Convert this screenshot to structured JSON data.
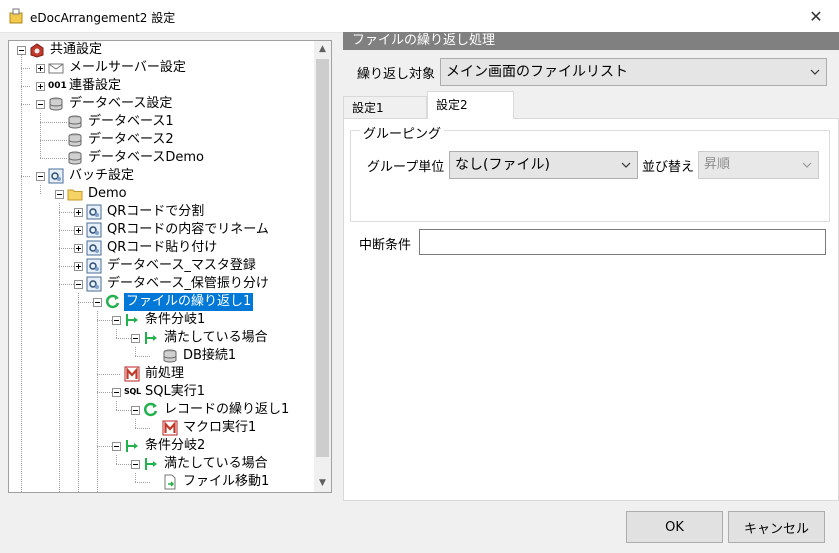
{
  "window": {
    "title": "eDocArrangement2 設定",
    "close_glyph": "✕"
  },
  "tree": {
    "nodes": [
      {
        "label": "共通設定",
        "icon": "gear-box-icon"
      },
      {
        "label": "メールサーバー設定",
        "icon": "mail-icon"
      },
      {
        "label": "連番設定",
        "icon": "number-icon",
        "icon_text": "001"
      },
      {
        "label": "データベース設定",
        "icon": "database-icon"
      },
      {
        "label": "データベース1",
        "icon": "database-icon"
      },
      {
        "label": "データベース2",
        "icon": "database-icon"
      },
      {
        "label": "データベースDemo",
        "icon": "database-icon"
      },
      {
        "label": "バッチ設定",
        "icon": "batch-icon"
      },
      {
        "label": "Demo",
        "icon": "folder-icon"
      },
      {
        "label": "QRコードで分割",
        "icon": "batch-icon"
      },
      {
        "label": "QRコードの内容でリネーム",
        "icon": "batch-icon"
      },
      {
        "label": "QRコード貼り付け",
        "icon": "batch-icon"
      },
      {
        "label": "データベース_マスタ登録",
        "icon": "batch-icon"
      },
      {
        "label": "データベース_保管振り分け",
        "icon": "batch-icon"
      },
      {
        "label": "ファイルの繰り返し1",
        "icon": "loop-icon"
      },
      {
        "label": "条件分岐1",
        "icon": "branch-icon"
      },
      {
        "label": "満たしている場合",
        "icon": "branch-icon"
      },
      {
        "label": "DB接続1",
        "icon": "database-icon"
      },
      {
        "label": "前処理",
        "icon": "macro-icon"
      },
      {
        "label": "SQL実行1",
        "icon": "sql-icon",
        "icon_text": "SQL"
      },
      {
        "label": "レコードの繰り返し1",
        "icon": "loop-icon"
      },
      {
        "label": "マクロ実行1",
        "icon": "macro-icon"
      },
      {
        "label": "条件分岐2",
        "icon": "branch-icon"
      },
      {
        "label": "満たしている場合",
        "icon": "branch-icon"
      },
      {
        "label": "ファイル移動1",
        "icon": "file-move-icon"
      }
    ],
    "scroll_up": "▲",
    "scroll_down": "▼"
  },
  "panel": {
    "header": "ファイルの繰り返し処理",
    "target_label": "繰り返し対象",
    "target_value": "メイン画面のファイルリスト",
    "tabs": [
      "設定1",
      "設定2"
    ],
    "active_tab": "設定2",
    "grouping": {
      "title": "グルーピング",
      "unit_label": "グループ単位",
      "unit_value": "なし(ファイル)",
      "sort_label": "並び替え",
      "sort_value": "昇順"
    },
    "abort_label": "中断条件",
    "abort_value": ""
  },
  "buttons": {
    "ok": "OK",
    "cancel": "キャンセル"
  },
  "colors": {
    "selection": "#0078d7",
    "header_bg": "#808080",
    "loop_green": "#22b14c"
  }
}
